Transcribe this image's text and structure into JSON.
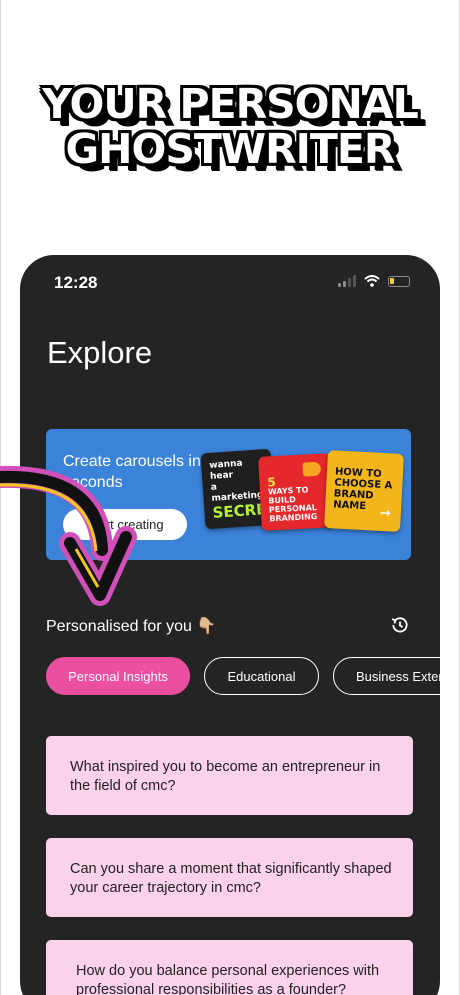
{
  "headline": {
    "line1": "YOUR PERSONAL",
    "line2": "GHOSTWRITER"
  },
  "status_bar": {
    "time": "12:28"
  },
  "screen": {
    "title": "Explore"
  },
  "banner": {
    "text": "Create carousels in seconds",
    "button_label": "Start creating",
    "cards": {
      "black": {
        "line1": "wanna hear",
        "line2": "a marketing",
        "big": "SECRET?"
      },
      "red": {
        "num": "5",
        "text": "WAYS TO BUILD PERSONAL BRANDING"
      },
      "yellow": {
        "text": "HOW TO CHOOSE A BRAND NAME",
        "arrow": "→"
      }
    }
  },
  "personalised": {
    "title": "Personalised for you",
    "emoji": "👇🏼"
  },
  "chips": [
    {
      "label": "Personal Insights",
      "active": true
    },
    {
      "label": "Educational",
      "active": false
    },
    {
      "label": "Business Exter",
      "active": false
    }
  ],
  "questions": [
    "What inspired you to become an entrepreneur in the field of cmc?",
    "Can you share a moment that significantly shaped your career trajectory in cmc?",
    "How do you balance personal experiences with professional responsibilities as a founder?"
  ],
  "colors": {
    "accent_pink": "#ea4fa0",
    "card_pink": "#fbd2ea",
    "banner_blue": "#3b82d9",
    "phone_bg": "#242424"
  }
}
